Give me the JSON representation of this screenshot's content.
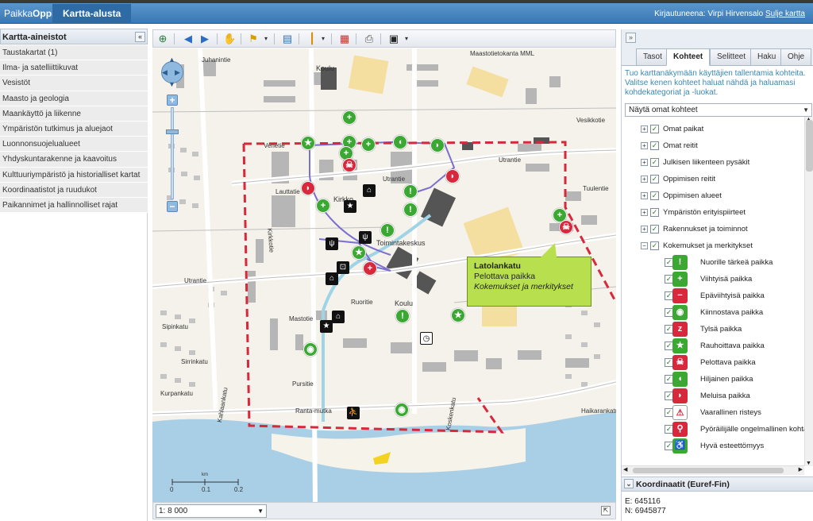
{
  "app": {
    "brand_prefix": "Paikka",
    "brand_suffix": "Oppi",
    "main_tab": "Kartta-alusta"
  },
  "login": {
    "label": "Kirjautuneena: Virpi Hirvensalo",
    "logout": "Sulje kartta"
  },
  "left": {
    "title": "Kartta-aineistot",
    "items": [
      "Taustakartat (1)",
      "Ilma- ja satelliittikuvat",
      "Vesistöt",
      "Maasto ja geologia",
      "Maankäyttö ja liikenne",
      "Ympäristön tutkimus ja aluejaot",
      "Luonnonsuojelualueet",
      "Yhdyskuntarakenne ja kaavoitus",
      "Kulttuuriympäristö ja historialliset kartat",
      "Koordinaatistot ja ruudukot",
      "Paikannimet ja hallinnolliset rajat"
    ]
  },
  "toolbar": {
    "icons": [
      "zoom-extent-icon",
      "back-icon",
      "forward-icon",
      "pan-hand-icon",
      "select-icon",
      "layers-icon",
      "measure-icon",
      "legend-icon",
      "print-icon",
      "save-icon"
    ]
  },
  "map": {
    "attribution": "Maastotietokanta MML",
    "labels": {
      "koulu1": "Koulu",
      "koulu2": "Koulu",
      "kirkko": "Kirkko",
      "juhanintie": "Juhanintie",
      "venetie": "Venetie",
      "lauttatie": "Lauttatie",
      "utrantie1": "Utrantie",
      "utrantie2": "Utrantie",
      "utrantie3": "Utrantie",
      "toimintakeskus": "Toimintakeskus",
      "ruoritie": "Ruoritie",
      "mastotie": "Mastotie",
      "pursitie": "Pursitie",
      "sirrinkatu": "Sirrinkatu",
      "sipinkatu": "Sipinkatu",
      "kurpankatu": "Kurpankatu",
      "kahiaankatu": "Kahlaankatu",
      "rantamutka": "Ranta-mutka",
      "vesikkotie": "Vesikkotie",
      "tuulentie": "Tuulentie",
      "haikarankatu": "Haikarankatu",
      "koskenkatu": "Koskenkatu",
      "kirkkotie": "Kirkkotie"
    },
    "scale_ticks": [
      "0",
      "0.1",
      "0.2"
    ],
    "scale_unit": "km",
    "callout": {
      "title": "Latolankatu",
      "subtitle": "Pelottava paikka",
      "category": "Kokemukset ja merkitykset"
    }
  },
  "status": {
    "scale": "1: 8 000"
  },
  "right": {
    "tabs": [
      "Tasot",
      "Kohteet",
      "Selitteet",
      "Haku",
      "Ohje"
    ],
    "active_tab": "Kohteet",
    "info": "Tuo karttanäkymään käyttäjien tallentamia kohteita. Valitse kenen kohteet haluat nähdä ja haluamasi kohdekategoriat ja -luokat.",
    "select_value": "Näytä omat kohteet",
    "tree": [
      {
        "label": "Omat paikat",
        "type": "expand",
        "exp": "+"
      },
      {
        "label": "Omat reitit",
        "type": "expand",
        "exp": "+"
      },
      {
        "label": "Julkisen liikenteen pysäkit",
        "type": "expand",
        "exp": "+"
      },
      {
        "label": "Oppimisen reitit",
        "type": "expand",
        "exp": "+"
      },
      {
        "label": "Oppimisen alueet",
        "type": "expand",
        "exp": "+"
      },
      {
        "label": "Ympäristön erityispiirteet",
        "type": "expand",
        "exp": "+"
      },
      {
        "label": "Rakennukset ja toiminnot",
        "type": "expand",
        "exp": "+"
      },
      {
        "label": "Kokemukset ja merkitykset",
        "type": "expand",
        "exp": "-"
      },
      {
        "label": "Nuorille tärkeä paikka",
        "type": "child",
        "color": "#3aa832",
        "glyph": "!"
      },
      {
        "label": "Viihtyisä paikka",
        "type": "child",
        "color": "#3aa832",
        "glyph": "+"
      },
      {
        "label": "Epäviihtyisä paikka",
        "type": "child",
        "color": "#d8283c",
        "glyph": "−"
      },
      {
        "label": "Kiinnostava paikka",
        "type": "child",
        "color": "#3aa832",
        "glyph": "◉"
      },
      {
        "label": "Tylsä paikka",
        "type": "child",
        "color": "#d8283c",
        "glyph": "z"
      },
      {
        "label": "Rauhoittava paikka",
        "type": "child",
        "color": "#3aa832",
        "glyph": "★"
      },
      {
        "label": "Pelottava paikka",
        "type": "child",
        "color": "#d8283c",
        "glyph": "☠"
      },
      {
        "label": "Hiljainen paikka",
        "type": "child",
        "color": "#3aa832",
        "glyph": "◖"
      },
      {
        "label": "Meluisa paikka",
        "type": "child",
        "color": "#d8283c",
        "glyph": "◗"
      },
      {
        "label": "Vaarallinen risteys",
        "type": "child",
        "color": "#ffffff",
        "glyph": "⚠"
      },
      {
        "label": "Pyöräilijälle ongelmallinen kohta",
        "type": "child",
        "color": "#d8283c",
        "glyph": "⚲"
      },
      {
        "label": "Hyvä esteettömyys",
        "type": "child",
        "color": "#3aa832",
        "glyph": "♿"
      }
    ],
    "coords": {
      "title": "Koordinaatit (Euref-Fin)",
      "e": "E: 645116",
      "n": "N: 6945877"
    }
  },
  "colors": {
    "topbar": "#4a88c2",
    "green": "#3aa832",
    "red": "#d8283c",
    "callout": "#b8e04e",
    "border_red": "#d8283c"
  }
}
